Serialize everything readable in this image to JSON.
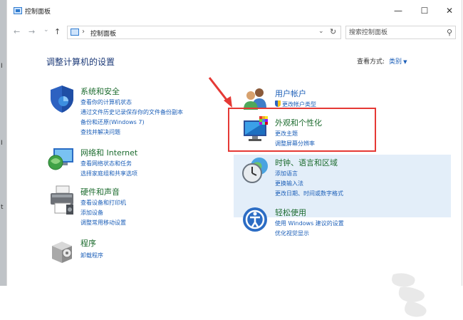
{
  "window": {
    "title": "控制面板",
    "minimize": "—",
    "maximize": "☐",
    "close": "✕"
  },
  "nav": {
    "back": "←",
    "forward": "→",
    "dropdown": "⌄",
    "up": "↑",
    "sep": "›",
    "breadcrumb": "控制面板",
    "addr_dropdown": "⌄",
    "refresh": "↻",
    "search_placeholder": "搜索控制面板",
    "search_icon": "⚲"
  },
  "edge_marks": [
    "I",
    "I",
    "t"
  ],
  "main": {
    "heading": "调整计算机的设置",
    "view_by_label": "查看方式:",
    "view_by_value": "类别",
    "view_by_arrow": "▼"
  },
  "categories": [
    {
      "title": "系统和安全",
      "links": [
        "查看你的计算机状态",
        "通过文件历史记录保存你的文件备份副本",
        "备份和还原(Windows 7)",
        "查找并解决问题"
      ]
    },
    {
      "title": "网络和 Internet",
      "links": [
        "查看网络状态和任务",
        "选择家庭组和共享选项"
      ]
    },
    {
      "title": "硬件和声音",
      "links": [
        "查看设备和打印机",
        "添加设备",
        "调整常用移动设置"
      ]
    },
    {
      "title": "程序",
      "links": [
        "卸载程序"
      ]
    },
    {
      "title": "用户帐户",
      "links": [
        "更改帐户类型"
      ]
    },
    {
      "title": "外观和个性化",
      "links": [
        "更改主题",
        "调整屏幕分辨率"
      ]
    },
    {
      "title": "时钟、语言和区域",
      "links": [
        "添加语言",
        "更换输入法",
        "更改日期、时间或数字格式"
      ]
    },
    {
      "title": "轻松使用",
      "links": [
        "使用 Windows 建议的设置",
        "优化视觉显示"
      ]
    }
  ],
  "colors": {
    "category_title": "#1c6b2e",
    "link": "#1c5fb8",
    "highlight_box": "#e53935",
    "hover_bg": "#e3eef9",
    "heading": "#1c3a78"
  }
}
